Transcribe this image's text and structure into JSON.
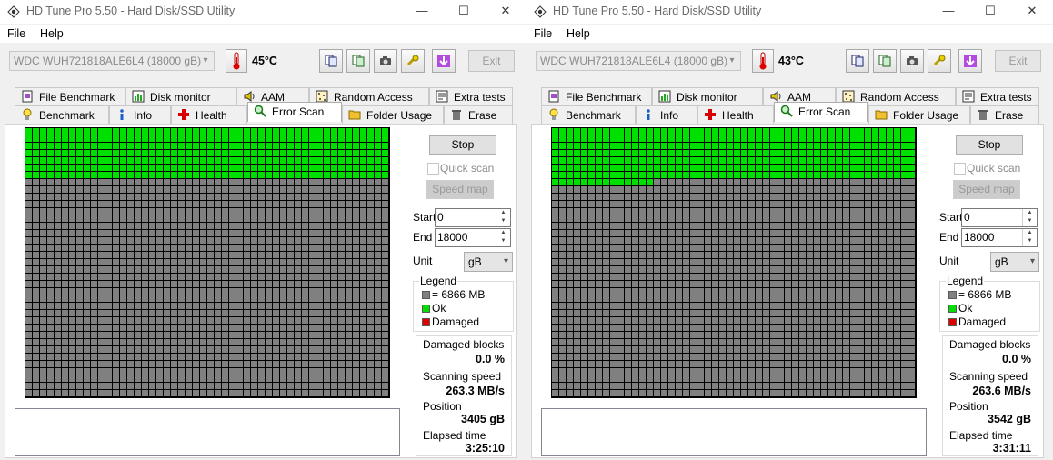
{
  "colors": {
    "ok": "#00e000",
    "unscanned": "#808080",
    "damaged": "#e00000",
    "grid_line": "#000000"
  },
  "menu": {
    "file": "File",
    "help": "Help"
  },
  "window_controls": {
    "minimize": "—",
    "maximize": "☐",
    "close": "✕"
  },
  "windows": [
    {
      "title": "HD Tune Pro 5.50 - Hard Disk/SSD Utility",
      "drive": "WDC  WUH721818ALE6L4 (18000 gB)",
      "temperature": "45°C",
      "exit_label": "Exit",
      "tabs_top": [
        "File Benchmark",
        "Disk monitor",
        "AAM",
        "Random Access",
        "Extra tests"
      ],
      "tabs_bottom": [
        "Benchmark",
        "Info",
        "Health",
        "Error Scan",
        "Folder Usage",
        "Erase"
      ],
      "active_tab": "Error Scan",
      "stop_label": "Stop",
      "quick_scan_label": "Quick scan",
      "speed_map_label": "Speed map",
      "start_label": "Start",
      "start_value": "0",
      "end_label": "End",
      "end_value": "18000",
      "unit_label": "Unit",
      "unit_value": "gB",
      "legend_title": "Legend",
      "legend_block": "= 6866 MB",
      "legend_ok": "Ok",
      "legend_damaged": "Damaged",
      "damaged_blocks_label": "Damaged blocks",
      "damaged_blocks_value": "0.0 %",
      "scanning_speed_label": "Scanning speed",
      "scanning_speed_value": "263.3 MB/s",
      "position_label": "Position",
      "position_value": "3405 gB",
      "elapsed_label": "Elapsed time",
      "elapsed_value": "3:25:10",
      "scan_progress": 0.1892
    },
    {
      "title": "HD Tune Pro 5.50 - Hard Disk/SSD Utility",
      "drive": "WDC  WUH721818ALE6L4 (18000 gB)",
      "temperature": "43°C",
      "exit_label": "Exit",
      "tabs_top": [
        "File Benchmark",
        "Disk monitor",
        "AAM",
        "Random Access",
        "Extra tests"
      ],
      "tabs_bottom": [
        "Benchmark",
        "Info",
        "Health",
        "Error Scan",
        "Folder Usage",
        "Erase"
      ],
      "active_tab": "Error Scan",
      "stop_label": "Stop",
      "quick_scan_label": "Quick scan",
      "speed_map_label": "Speed map",
      "start_label": "Start",
      "start_value": "0",
      "end_label": "End",
      "end_value": "18000",
      "unit_label": "Unit",
      "unit_value": "gB",
      "legend_title": "Legend",
      "legend_block": "= 6866 MB",
      "legend_ok": "Ok",
      "legend_damaged": "Damaged",
      "damaged_blocks_label": "Damaged blocks",
      "damaged_blocks_value": "0.0 %",
      "scanning_speed_label": "Scanning speed",
      "scanning_speed_value": "263.6 MB/s",
      "position_label": "Position",
      "position_value": "3542 gB",
      "elapsed_label": "Elapsed time",
      "elapsed_value": "3:31:11",
      "scan_progress": 0.1968
    }
  ]
}
